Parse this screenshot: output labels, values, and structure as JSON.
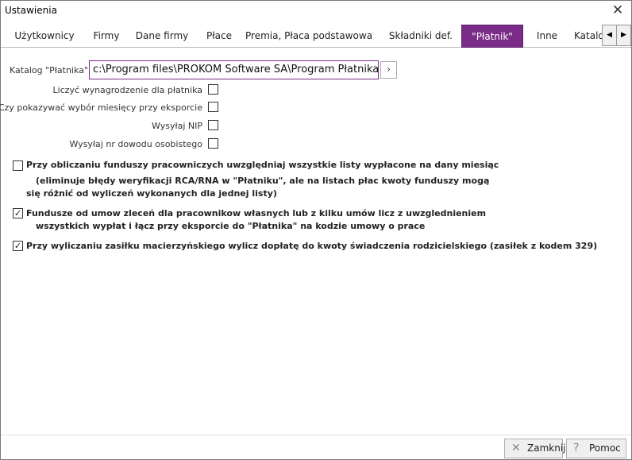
{
  "window": {
    "title": "Ustawienia"
  },
  "tabs": [
    {
      "label": "Użytkownicy"
    },
    {
      "label": "Firmy"
    },
    {
      "label": "Dane firmy"
    },
    {
      "label": "Płace"
    },
    {
      "label": "Premia, Płaca podstawowa"
    },
    {
      "label": "Składniki def."
    },
    {
      "label": "\"Płatnik\""
    },
    {
      "label": "Inne"
    },
    {
      "label": "Katalo"
    }
  ],
  "active_tab": "\"Płatnik\"",
  "catalog": {
    "label": "Katalog \"Płatnika\"",
    "value": "c:\\Program files\\PROKOM Software SA\\Program Płatnika\\",
    "browse_glyph": "›"
  },
  "small_options": [
    {
      "label": "Liczyć wynagrodzenie dla płatnika",
      "checked": false
    },
    {
      "label": "Czy pokazywać wybór miesięcy przy eksporcie",
      "checked": false
    },
    {
      "label": "Wysyłaj NIP",
      "checked": false
    },
    {
      "label": "Wysyłaj nr dowodu osobistego",
      "checked": false
    }
  ],
  "bold_options": [
    {
      "line1": "Przy obliczaniu funduszy pracowniczych uwzględniaj wszystkie listy wypłacone na dany miesiąc",
      "line2": "(eliminuje błędy weryfikacji RCA/RNA w \"Płatniku\", ale na listach płac kwoty funduszy mogą",
      "line3": "się różnić od wyliczeń wykonanych dla jednej listy)",
      "checked": false
    },
    {
      "line1": "Fundusze od umow zleceń dla pracownikow własnych lub z kilku umów licz z uwzglednieniem",
      "line2": "wszystkich wypłat i łącz przy eksporcie do \"Płatnika\" na kodzie umowy o prace",
      "checked": true
    },
    {
      "line1": "Przy wyliczaniu zasiłku macierzyńskiego wylicz dopłatę do kwoty świadczenia rodzicielskiego (zasiłek z kodem 329)",
      "checked": true
    }
  ],
  "footer": {
    "close_label": "Zamknij",
    "help_label": "Pomoc"
  },
  "icons": {
    "close": "✕",
    "check": "✓",
    "scroll_left": "◀",
    "scroll_right": "▶",
    "help": "?"
  }
}
